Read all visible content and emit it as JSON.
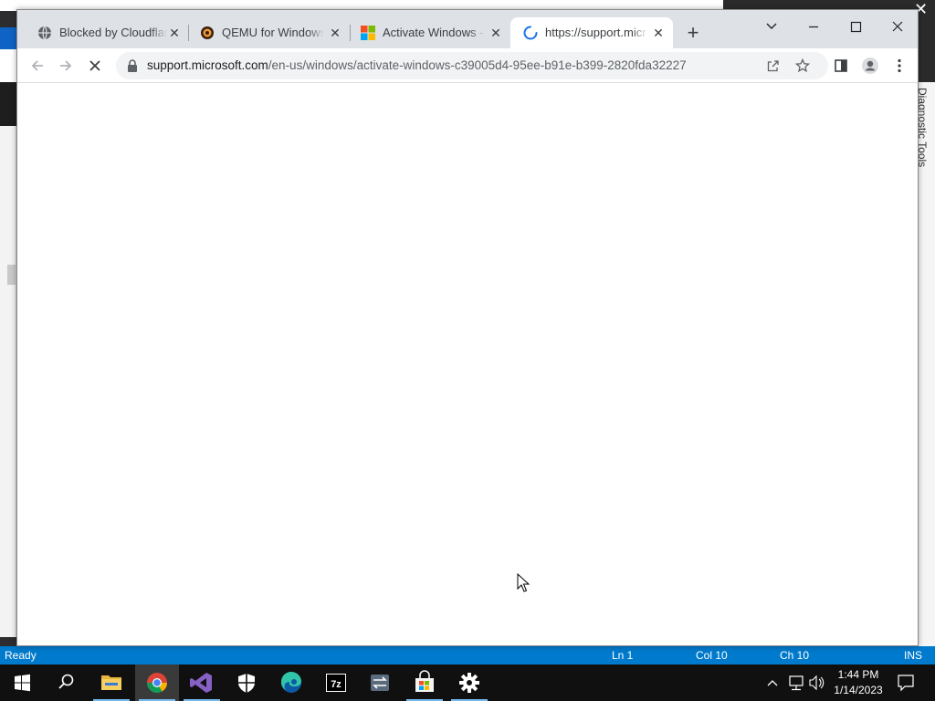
{
  "background_app": {
    "side_panel_label": "Diagnostic Tools"
  },
  "status_bar": {
    "ready": "Ready",
    "line": "Ln 1",
    "column": "Col 10",
    "char": "Ch 10",
    "mode": "INS"
  },
  "browser": {
    "tabs": [
      {
        "title": "Blocked by Cloudflare",
        "icon": "globe-icon",
        "active": false
      },
      {
        "title": "QEMU for Windows - Installers",
        "icon": "qemu-icon",
        "active": false
      },
      {
        "title": "Activate Windows - Microsoft Support",
        "icon": "microsoft-icon",
        "active": false
      },
      {
        "title": "https://support.microsoft.com",
        "icon": "loading-spinner-icon",
        "active": true
      }
    ],
    "new_tab_label": "+",
    "address_bar": {
      "host": "support.microsoft.com",
      "path": "/en-us/windows/activate-windows-c39005d4-95ee-b91e-b399-2820fda32227"
    },
    "colors": {
      "tabstrip": "#dee1e6",
      "omnibox": "#f1f3f4"
    }
  },
  "taskbar": {
    "items": [
      {
        "name": "start-button",
        "icon": "windows-logo-icon"
      },
      {
        "name": "search-button",
        "icon": "search-icon"
      },
      {
        "name": "file-explorer",
        "icon": "folder-icon"
      },
      {
        "name": "chrome",
        "icon": "chrome-icon"
      },
      {
        "name": "visual-studio",
        "icon": "visual-studio-icon"
      },
      {
        "name": "windows-security",
        "icon": "shield-icon"
      },
      {
        "name": "edge",
        "icon": "edge-icon"
      },
      {
        "name": "7zip",
        "icon": "7zip-icon"
      },
      {
        "name": "remote-desktop",
        "icon": "transfer-icon"
      },
      {
        "name": "store",
        "icon": "store-icon"
      },
      {
        "name": "settings",
        "icon": "gear-icon"
      }
    ],
    "clock": {
      "time": "1:44 PM",
      "date": "1/14/2023"
    },
    "colors": {
      "background": "#101010",
      "running_indicator": "#76b9ed"
    }
  },
  "status_bar_color": "#007acc"
}
